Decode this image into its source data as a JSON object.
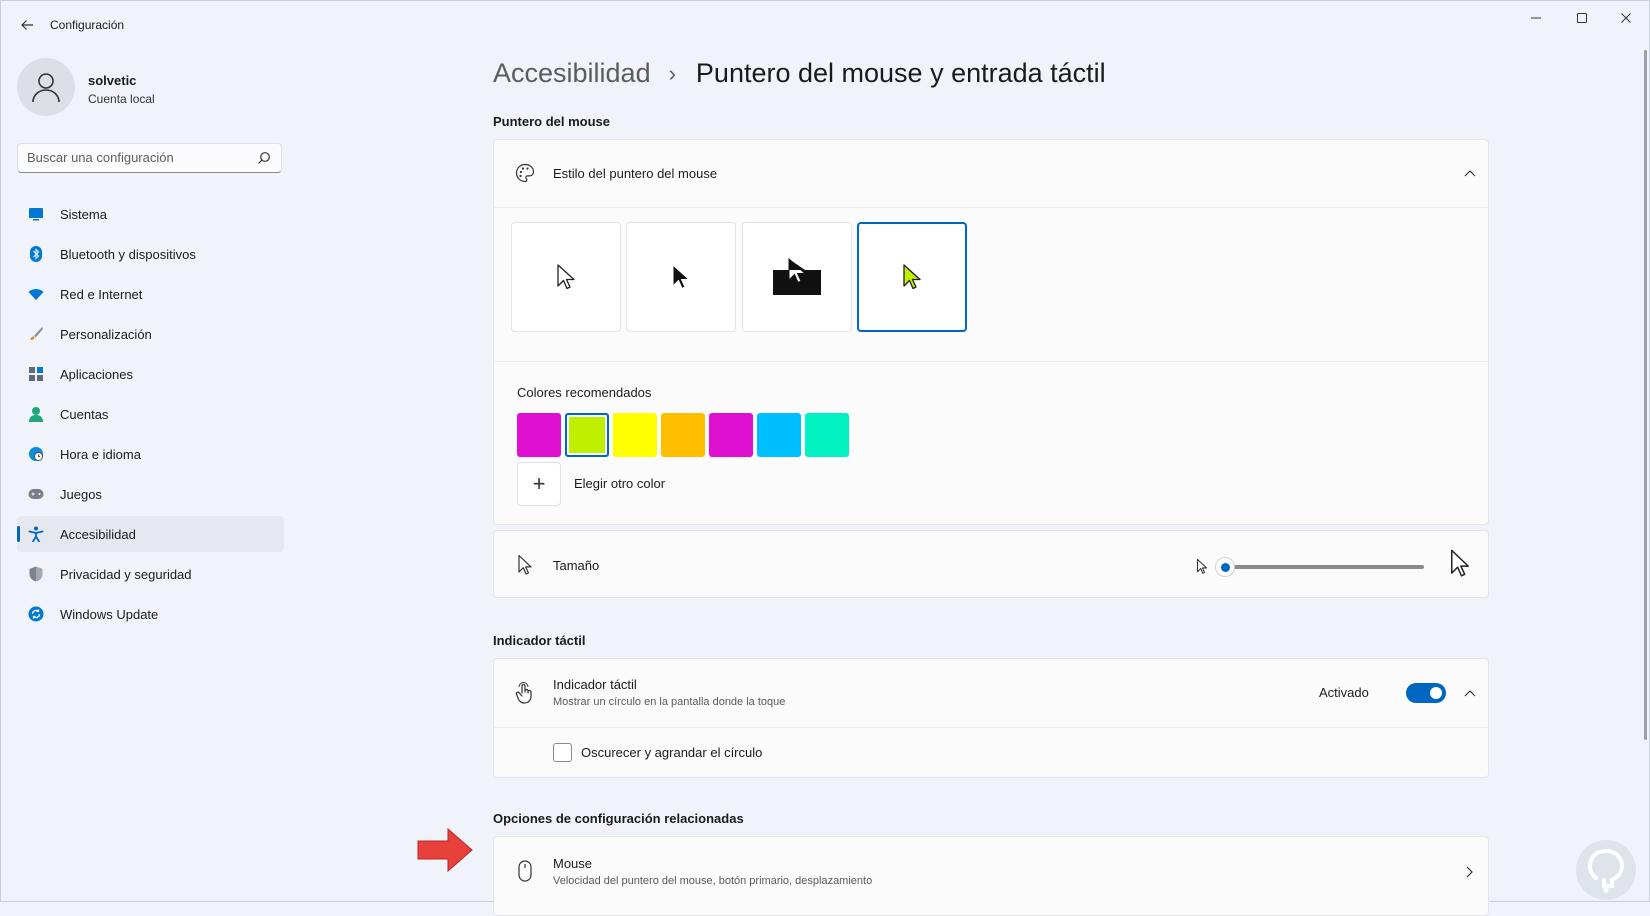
{
  "window": {
    "title": "Configuración"
  },
  "user": {
    "name": "solvetic",
    "account_type": "Cuenta local"
  },
  "search": {
    "placeholder": "Buscar una configuración"
  },
  "sidebar": {
    "items": [
      {
        "label": "Sistema",
        "icon": "system-icon",
        "color": "#0078d4"
      },
      {
        "label": "Bluetooth y dispositivos",
        "icon": "bluetooth-icon",
        "color": "#0078d4"
      },
      {
        "label": "Red e Internet",
        "icon": "wifi-icon",
        "color": "#0078d4"
      },
      {
        "label": "Personalización",
        "icon": "brush-icon",
        "color": "#e0862d"
      },
      {
        "label": "Aplicaciones",
        "icon": "apps-icon",
        "color": "#5a6b7c"
      },
      {
        "label": "Cuentas",
        "icon": "account-icon",
        "color": "#1fa67a"
      },
      {
        "label": "Hora e idioma",
        "icon": "globe-clock-icon",
        "color": "#0a8fd6"
      },
      {
        "label": "Juegos",
        "icon": "gamepad-icon",
        "color": "#7a7f87"
      },
      {
        "label": "Accesibilidad",
        "icon": "accessibility-icon",
        "color": "#0067c0",
        "active": true
      },
      {
        "label": "Privacidad y seguridad",
        "icon": "shield-icon",
        "color": "#6b7280"
      },
      {
        "label": "Windows Update",
        "icon": "update-icon",
        "color": "#0078d4"
      }
    ]
  },
  "breadcrumb": {
    "parent": "Accesibilidad",
    "current": "Puntero del mouse y entrada táctil"
  },
  "mouse_pointer": {
    "section_title": "Puntero del mouse",
    "style_label": "Estilo del puntero del mouse",
    "styles": [
      "white",
      "black",
      "inverted",
      "custom"
    ],
    "selected_style": "custom",
    "colors_label": "Colores recomendados",
    "colors": [
      "#e010d0",
      "#bff000",
      "#ffff00",
      "#ffbf00",
      "#e010d0",
      "#00bfff",
      "#00f2c0"
    ],
    "selected_color": "#bff000",
    "add_color_label": "Elegir otro color",
    "size_label": "Tamaño",
    "size_value": 0
  },
  "touch": {
    "section_title": "Indicador táctil",
    "label": "Indicador táctil",
    "sublabel": "Mostrar un círculo en la pantalla donde la toque",
    "toggle_label": "Activado",
    "toggle_on": true,
    "checkbox_label": "Oscurecer y agrandar el círculo",
    "checkbox_checked": false
  },
  "related": {
    "section_title": "Opciones de configuración relacionadas",
    "mouse_label": "Mouse",
    "mouse_sub": "Velocidad del puntero del mouse, botón primario, desplazamiento"
  },
  "accent": "#0067c0"
}
